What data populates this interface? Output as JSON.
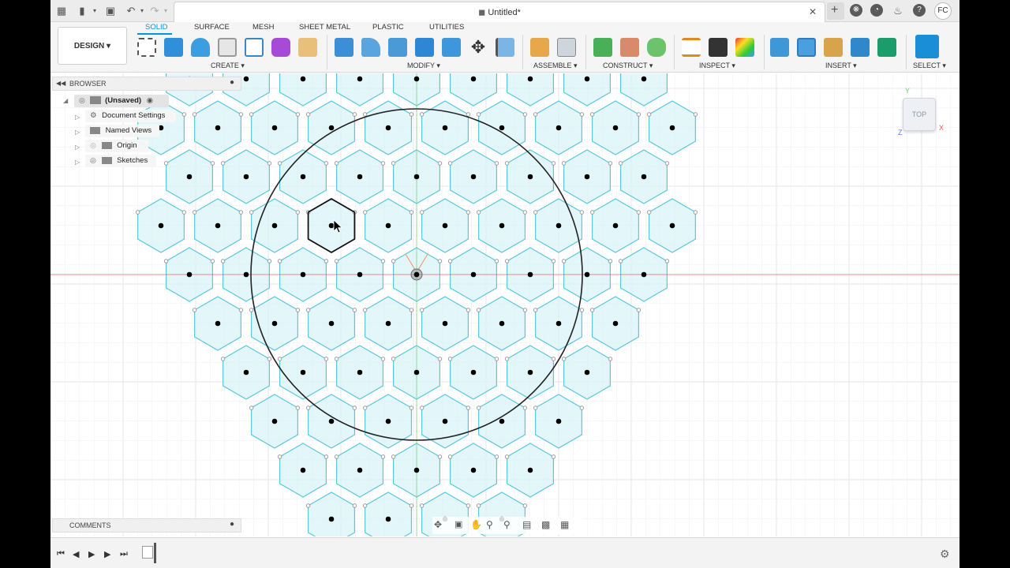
{
  "window": {
    "title": "Untitled*",
    "user_initials": "FC"
  },
  "workspace": {
    "label": "DESIGN ▾"
  },
  "tabs": [
    "SOLID",
    "SURFACE",
    "MESH",
    "SHEET METAL",
    "PLASTIC",
    "UTILITIES"
  ],
  "groups": [
    "CREATE ▾",
    "MODIFY ▾",
    "ASSEMBLE ▾",
    "CONSTRUCT ▾",
    "INSPECT ▾",
    "INSERT ▾",
    "SELECT ▾"
  ],
  "browser": {
    "title": "BROWSER",
    "root": "(Unsaved)",
    "items": [
      "Document Settings",
      "Named Views",
      "Origin",
      "Sketches"
    ]
  },
  "comments_label": "COMMENTS",
  "viewcube": {
    "face": "TOP",
    "axes": [
      "Y",
      "X",
      "Z"
    ]
  },
  "colors": {
    "accent": "#0696d7",
    "hex_fill": "#d9f3f8",
    "hex_stroke": "#5bc8dd",
    "x_axis": "#e35b5b",
    "y_axis": "#6fc96f"
  }
}
